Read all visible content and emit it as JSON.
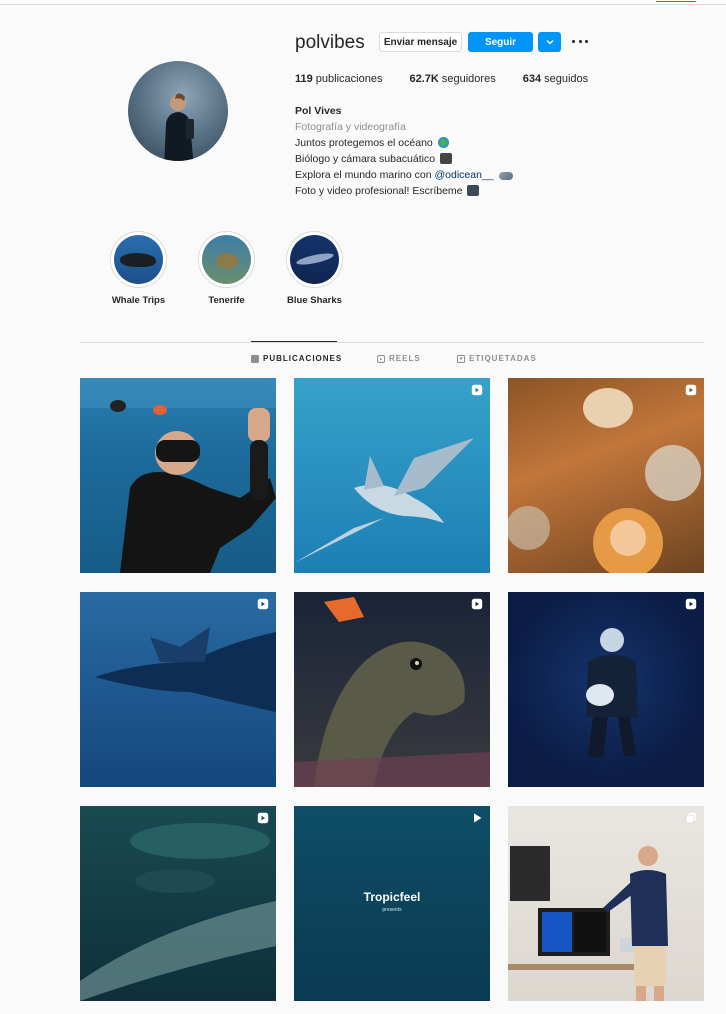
{
  "profile": {
    "username": "polvibes",
    "message_label": "Enviar mensaje",
    "follow_label": "Seguir",
    "stats": {
      "posts_count": "119",
      "posts_label": " publicaciones",
      "followers_count": "62.7K",
      "followers_label": " seguidores",
      "following_count": "634",
      "following_label": " seguidos"
    },
    "bio": {
      "full_name": "Pol Vives",
      "category": "Fotografía y videografía",
      "line1": "Juntos protegemos el océano",
      "line2": "Biólogo y cámara subacuático",
      "line3_prefix": "Explora el mundo marino con ",
      "line3_mention": "@odicean__",
      "line4": "Foto y video profesional! Escríbeme"
    }
  },
  "highlights": [
    {
      "label": "Whale Trips",
      "icon": "whale-thumbnail"
    },
    {
      "label": "Tenerife",
      "icon": "turtle-thumbnail"
    },
    {
      "label": "Blue Sharks",
      "icon": "shark-thumbnail"
    }
  ],
  "tabs": [
    {
      "label": "PUBLICACIONES",
      "icon": "grid-icon",
      "active": true
    },
    {
      "label": "REELS",
      "icon": "reels-icon",
      "active": false
    },
    {
      "label": "ETIQUETADAS",
      "icon": "tagged-icon",
      "active": false
    }
  ],
  "posts": [
    {
      "subject": "diver selfie",
      "type": "photo"
    },
    {
      "subject": "blue shark",
      "type": "reel"
    },
    {
      "subject": "octopus",
      "type": "reel"
    },
    {
      "subject": "manta ray",
      "type": "reel"
    },
    {
      "subject": "moray eel",
      "type": "reel"
    },
    {
      "subject": "diver with camera",
      "type": "reel"
    },
    {
      "subject": "whale shark",
      "type": "reel"
    },
    {
      "subject": "Tropicfeel presents",
      "type": "video",
      "overlay_title": "Tropicfeel",
      "overlay_sub": "presents"
    },
    {
      "subject": "man at presentation",
      "type": "carousel"
    }
  ],
  "colors": {
    "accent": "#0095f6",
    "mention": "#00376b"
  }
}
